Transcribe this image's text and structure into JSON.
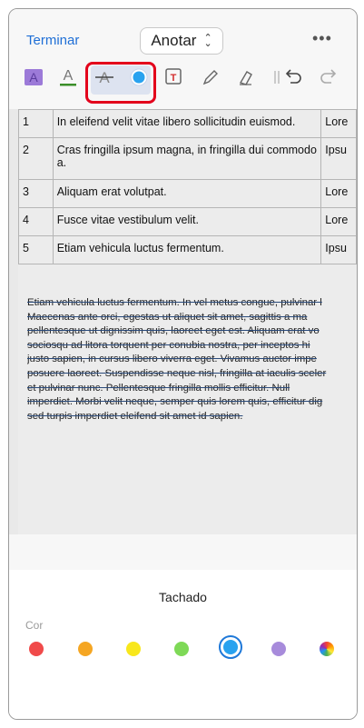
{
  "header": {
    "done_label": "Terminar",
    "mode_label": "Anotar",
    "more_label": "•••"
  },
  "toolbar": {
    "tools": [
      {
        "name": "highlight-tool",
        "glyph": "A"
      },
      {
        "name": "underline-tool",
        "glyph": "A"
      },
      {
        "name": "strikethrough-tool",
        "glyph": "A"
      },
      {
        "name": "color-tool",
        "glyph": ""
      },
      {
        "name": "text-box-tool",
        "glyph": "T"
      },
      {
        "name": "pencil-tool",
        "glyph": ""
      },
      {
        "name": "eraser-tool",
        "glyph": ""
      },
      {
        "name": "undo-tool",
        "glyph": "↶"
      },
      {
        "name": "redo-tool",
        "glyph": "↷"
      }
    ],
    "selected_color": "#29a2ef"
  },
  "table": {
    "rows": [
      {
        "num": "1",
        "text": "In eleifend velit vitae libero sollicitudin euismod.",
        "extra": "Lore"
      },
      {
        "num": "2",
        "text": "Cras fringilla ipsum magna, in fringilla dui commodo a.",
        "extra": "Ipsu"
      },
      {
        "num": "3",
        "text": "Aliquam erat volutpat.",
        "extra": "Lore"
      },
      {
        "num": "4",
        "text": "Fusce vitae vestibulum velit.",
        "extra": "Lore"
      },
      {
        "num": "5",
        "text": "Etiam vehicula luctus fermentum.",
        "extra": "Ipsu"
      }
    ]
  },
  "paragraph": {
    "lines": [
      "Etiam vehicula luctus fermentum. In vel metus congue, pulvinar l",
      "Maecenas ante orci, egestas ut aliquet sit amet, sagittis a ma",
      "pellentesque ut dignissim quis, laoreet eget est. Aliquam erat vo",
      "sociosqu ad litora torquent per conubia nostra, per inceptos hi",
      "justo sapien, in cursus libero viverra eget. Vivamus auctor impe",
      "posuere laoreet. Suspendisse neque nisl, fringilla at iaculis sceler",
      "et pulvinar nunc. Pellentesque fringilla mollis efficitur. Null",
      "imperdiet. Morbi velit neque, semper quis lorem quis, efficitur dig",
      "sed turpis imperdiet eleifend sit amet id sapien."
    ]
  },
  "sheet": {
    "title": "Tachado",
    "color_label": "Cor",
    "colors": [
      "#f04a4a",
      "#f5a623",
      "#f8e71c",
      "#7ed957",
      "#29a2ef",
      "#a78bdb",
      "rainbow"
    ],
    "selected_index": 4
  }
}
